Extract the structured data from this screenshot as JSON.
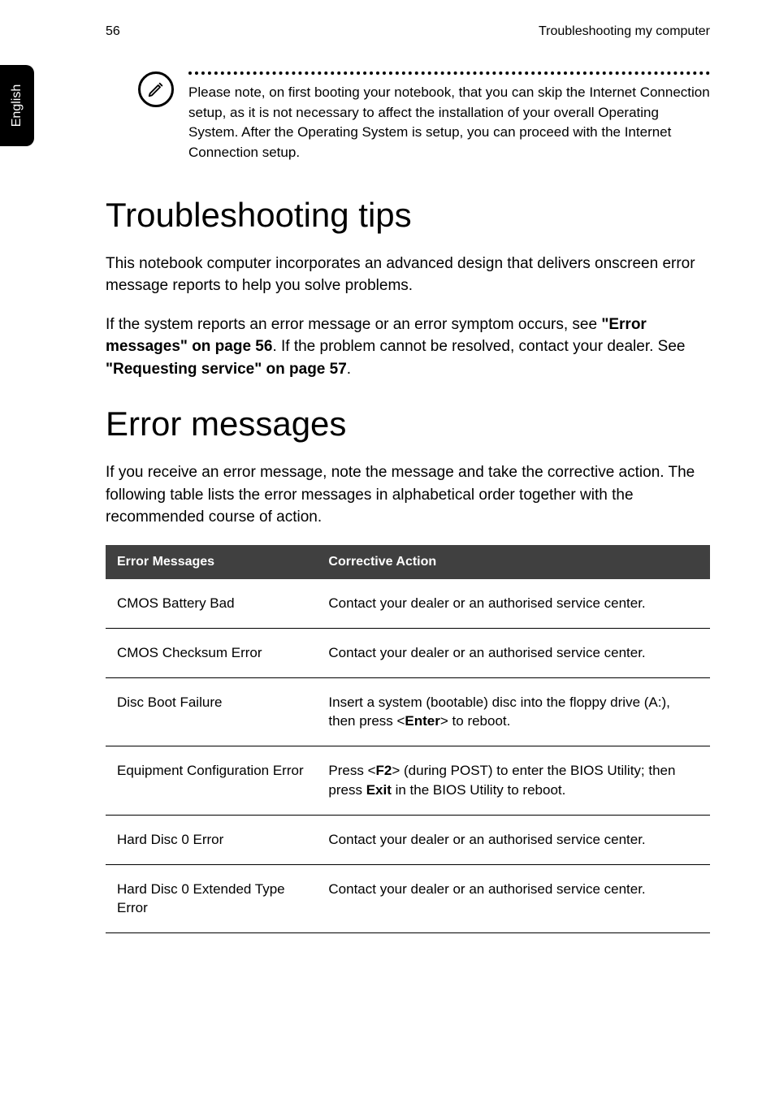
{
  "header": {
    "page_number": "56",
    "running_title": "Troubleshooting my computer"
  },
  "side_tab": {
    "label": "English"
  },
  "note": {
    "icon_name": "pencil-icon",
    "text": "Please note, on first booting your notebook, that you can skip the Internet Connection setup, as it is not necessary to affect the installation of your overall Operating System. After the Operating System is setup, you can proceed with the Internet Connection setup."
  },
  "section_tips": {
    "title": "Troubleshooting tips",
    "para1": "This notebook computer incorporates an advanced design that delivers onscreen error message reports to help you solve problems.",
    "para2_prefix": "If the system reports an error message or an error symptom occurs, see ",
    "para2_link1": "\"Error messages\" on page 56",
    "para2_mid": ". If the problem cannot be resolved, contact your dealer. See ",
    "para2_link2": "\"Requesting service\" on page 57",
    "para2_suffix": "."
  },
  "section_errors": {
    "title": "Error messages",
    "intro": "If you receive an error message, note the message and take the corrective action. The following table lists the error messages in alphabetical order together with the recommended course of action."
  },
  "table": {
    "head_col1": "Error Messages",
    "head_col2": "Corrective Action",
    "rows": [
      {
        "msg": "CMOS Battery Bad",
        "action_plain": "Contact your dealer or an authorised service center."
      },
      {
        "msg": "CMOS Checksum Error",
        "action_plain": "Contact your dealer or an authorised service center."
      },
      {
        "msg": "Disc Boot Failure",
        "action_prefix": "Insert a system (bootable) disc into the floppy drive (A:), then press <",
        "action_bold1": "Enter",
        "action_suffix": "> to reboot."
      },
      {
        "msg": "Equipment Configuration Error",
        "action_prefix": "Press <",
        "action_bold1": "F2",
        "action_mid": "> (during POST) to enter the BIOS Utility; then press ",
        "action_bold2": "Exit",
        "action_suffix": " in the BIOS Utility to reboot."
      },
      {
        "msg": "Hard Disc 0 Error",
        "action_plain": "Contact your dealer or an authorised service center."
      },
      {
        "msg": "Hard Disc 0 Extended Type Error",
        "action_plain": "Contact your dealer or an authorised service center."
      }
    ]
  }
}
